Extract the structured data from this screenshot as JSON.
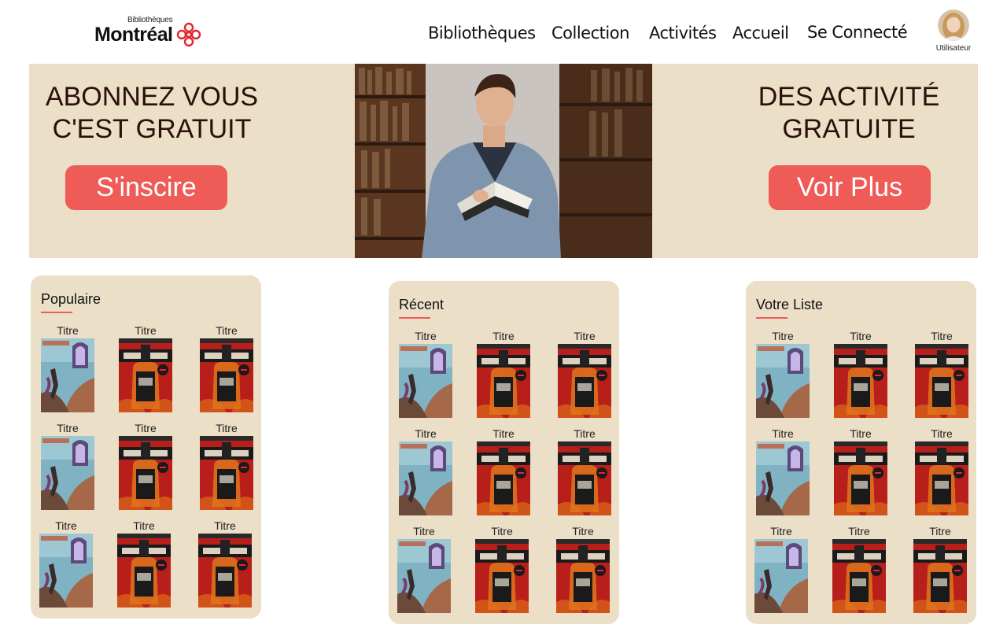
{
  "logo": {
    "small": "Bibliothèques",
    "main": "Montréal"
  },
  "nav": [
    "Bibliothèques",
    "Collection",
    "Activités",
    "Accueil",
    "Se Connecté"
  ],
  "user": {
    "label": "Utilisateur"
  },
  "hero": {
    "left_line1": "ABONNEZ VOUS",
    "left_line2": "C'EST GRATUIT",
    "left_button": "S'inscire",
    "right_line1": "DES ACTIVITÉ",
    "right_line2": "GRATUITE",
    "right_button": "Voir Plus"
  },
  "colors": {
    "accent": "#ef5b57",
    "panel": "#ebdfc8"
  },
  "sections": [
    {
      "title": "Populaire",
      "books": [
        "Titre",
        "Titre",
        "Titre",
        "Titre",
        "Titre",
        "Titre",
        "Titre",
        "Titre",
        "Titre"
      ]
    },
    {
      "title": "Récent",
      "books": [
        "Titre",
        "Titre",
        "Titre",
        "Titre",
        "Titre",
        "Titre",
        "Titre",
        "Titre",
        "Titre"
      ]
    },
    {
      "title": "Votre Liste",
      "books": [
        "Titre",
        "Titre",
        "Titre",
        "Titre",
        "Titre",
        "Titre",
        "Titre",
        "Titre",
        "Titre"
      ]
    }
  ]
}
